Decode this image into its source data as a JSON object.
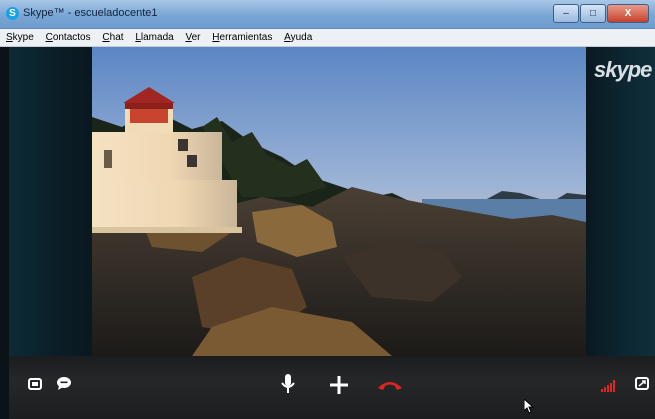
{
  "window": {
    "title": "Skype™ - escueladocente1",
    "app_icon_letter": "S"
  },
  "menu": {
    "items": [
      "Skype",
      "Contactos",
      "Chat",
      "Llamada",
      "Ver",
      "Herramientas",
      "Ayuda"
    ]
  },
  "window_controls": {
    "minimize": "–",
    "maximize": "□",
    "close": "X"
  },
  "brand": {
    "logo_text": "skype",
    "call_end_color": "#e0241f",
    "signal_color": "#e0241f"
  },
  "call_controls": {
    "left": [
      "screen-share-icon",
      "chat-bubble-icon"
    ],
    "center": [
      "microphone-icon",
      "add-icon",
      "hang-up-icon"
    ],
    "right": [
      "signal-strength-icon",
      "fullscreen-icon"
    ]
  }
}
